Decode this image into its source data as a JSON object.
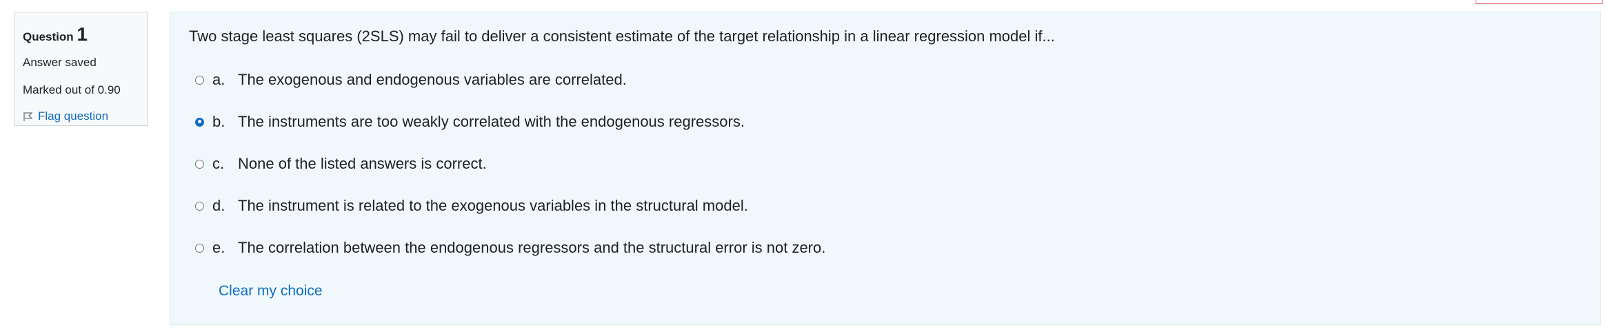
{
  "info": {
    "question_label": "Question",
    "question_number": "1",
    "state": "Answer saved",
    "grade": "Marked out of 0.90",
    "flag_label": "Flag question"
  },
  "question": {
    "text": "Two stage least squares (2SLS) may fail to deliver a consistent estimate of the target relationship in a linear regression model if...",
    "answers": [
      {
        "letter": "a.",
        "text": "The exogenous and endogenous variables are correlated.",
        "selected": false
      },
      {
        "letter": "b.",
        "text": "The instruments are too weakly correlated with the endogenous regressors.",
        "selected": true
      },
      {
        "letter": "c.",
        "text": "None of the listed answers is correct.",
        "selected": false
      },
      {
        "letter": "d.",
        "text": "The instrument is related to the exogenous variables in the structural model.",
        "selected": false
      },
      {
        "letter": "e.",
        "text": "The correlation between the endogenous regressors and the structural error is not zero.",
        "selected": false
      }
    ],
    "clear_label": "Clear my choice"
  },
  "colors": {
    "accent": "#0f6cbf",
    "content_bg": "#f1f8fb",
    "info_bg": "#f8f9fa"
  }
}
